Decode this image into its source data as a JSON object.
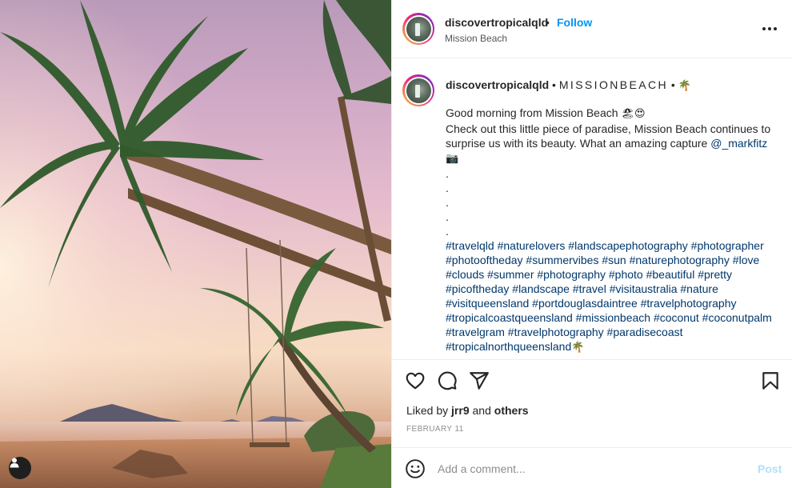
{
  "post": {
    "username": "discovertropicalqld",
    "follow_separator": "•",
    "follow_label": "Follow",
    "location": "Mission Beach"
  },
  "caption": {
    "username": "discovertropicalqld",
    "sep1": "•",
    "title": "MISSIONBEACH",
    "sep2": "•",
    "title_emoji": "🌴",
    "greeting": "Good morning from Mission Beach",
    "greeting_emojis": "🏖😍",
    "body_prefix": "Check out this little piece of paradise, Mission Beach continues to surprise us with its beauty. What an amazing capture",
    "mention": "@_markfitz",
    "camera_emoji": "📷",
    "spacer_dots": [
      ".",
      ".",
      ".",
      ".",
      "."
    ],
    "hashtags_lines": [
      "#travelqld #naturelovers #landscapephotography #photographer",
      "#photooftheday #summervibes #sun #naturephotography #love",
      "#clouds #summer #photography #photo #beautiful #pretty",
      "#picoftheday #landscape #travel #visitaustralia #nature",
      "#visitqueensland #portdouglasdaintree #travelphotography",
      "#tropicalcoastqueensland #missionbeach #coconut #coconutpalm",
      "#travelgram #travelphotography #paradisecoast",
      "#tropicalnorthqueensland"
    ],
    "end_emoji": "🌴"
  },
  "engagement": {
    "liked_by_prefix": "Liked by",
    "liked_by_user": "jrr9",
    "liked_by_and": "and",
    "liked_by_others": "others",
    "date": "FEBRUARY 11"
  },
  "comment": {
    "placeholder": "Add a comment...",
    "post_label": "Post"
  },
  "colors": {
    "link": "#00376b",
    "follow": "#0095f6",
    "post_disabled": "#b2dffc",
    "muted": "#8e8e8e"
  },
  "icons": [
    "user-tag-icon",
    "more-options-icon",
    "heart-icon",
    "comment-icon",
    "share-icon",
    "bookmark-icon",
    "emoji-icon"
  ]
}
